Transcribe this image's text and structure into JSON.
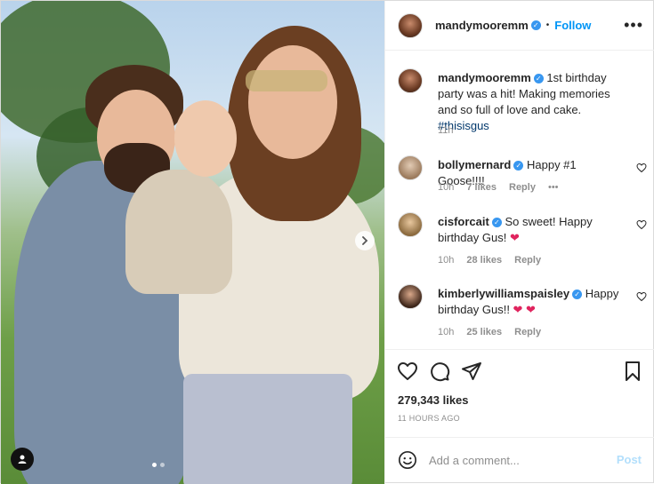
{
  "post": {
    "author": "mandymooremm",
    "follow_label": "Follow",
    "more_label": "•••",
    "separator": "•",
    "verified_mark": "✓"
  },
  "caption": {
    "username": "mandymooremm",
    "text": "1st birthday party was a hit! Making memories and so full of love and cake. ",
    "hashtag": "#thisisgus",
    "time": "11h"
  },
  "comments": [
    {
      "username": "bollymernard",
      "text": "Happy #1 Goose!!!!",
      "time": "10h",
      "likes": "7 likes",
      "reply": "Reply",
      "more": "•••",
      "hearts": ""
    },
    {
      "username": "cisforcait",
      "text": "So sweet! Happy birthday Gus! ",
      "time": "10h",
      "likes": "28 likes",
      "reply": "Reply",
      "hearts": "❤"
    },
    {
      "username": "kimberlywilliamspaisley",
      "text": "Happy birthday Gus!! ",
      "time": "10h",
      "likes": "25 likes",
      "reply": "Reply",
      "hearts": "❤ ❤"
    }
  ],
  "stats": {
    "likes": "279,343 likes",
    "time_ago": "11 HOURS AGO"
  },
  "add_comment": {
    "placeholder": "Add a comment...",
    "post_label": "Post"
  },
  "icons": {
    "like": "heart-icon",
    "comment": "comment-icon",
    "share": "share-icon",
    "save": "bookmark-icon",
    "emoji": "emoji-icon",
    "next": "chevron-right-icon",
    "tag": "user-tag-icon"
  },
  "colors": {
    "accent": "#0095f6",
    "verified": "#3897f0",
    "heart": "#e0245e",
    "muted": "#8e8e8e",
    "post_disabled": "#b2dffc"
  }
}
